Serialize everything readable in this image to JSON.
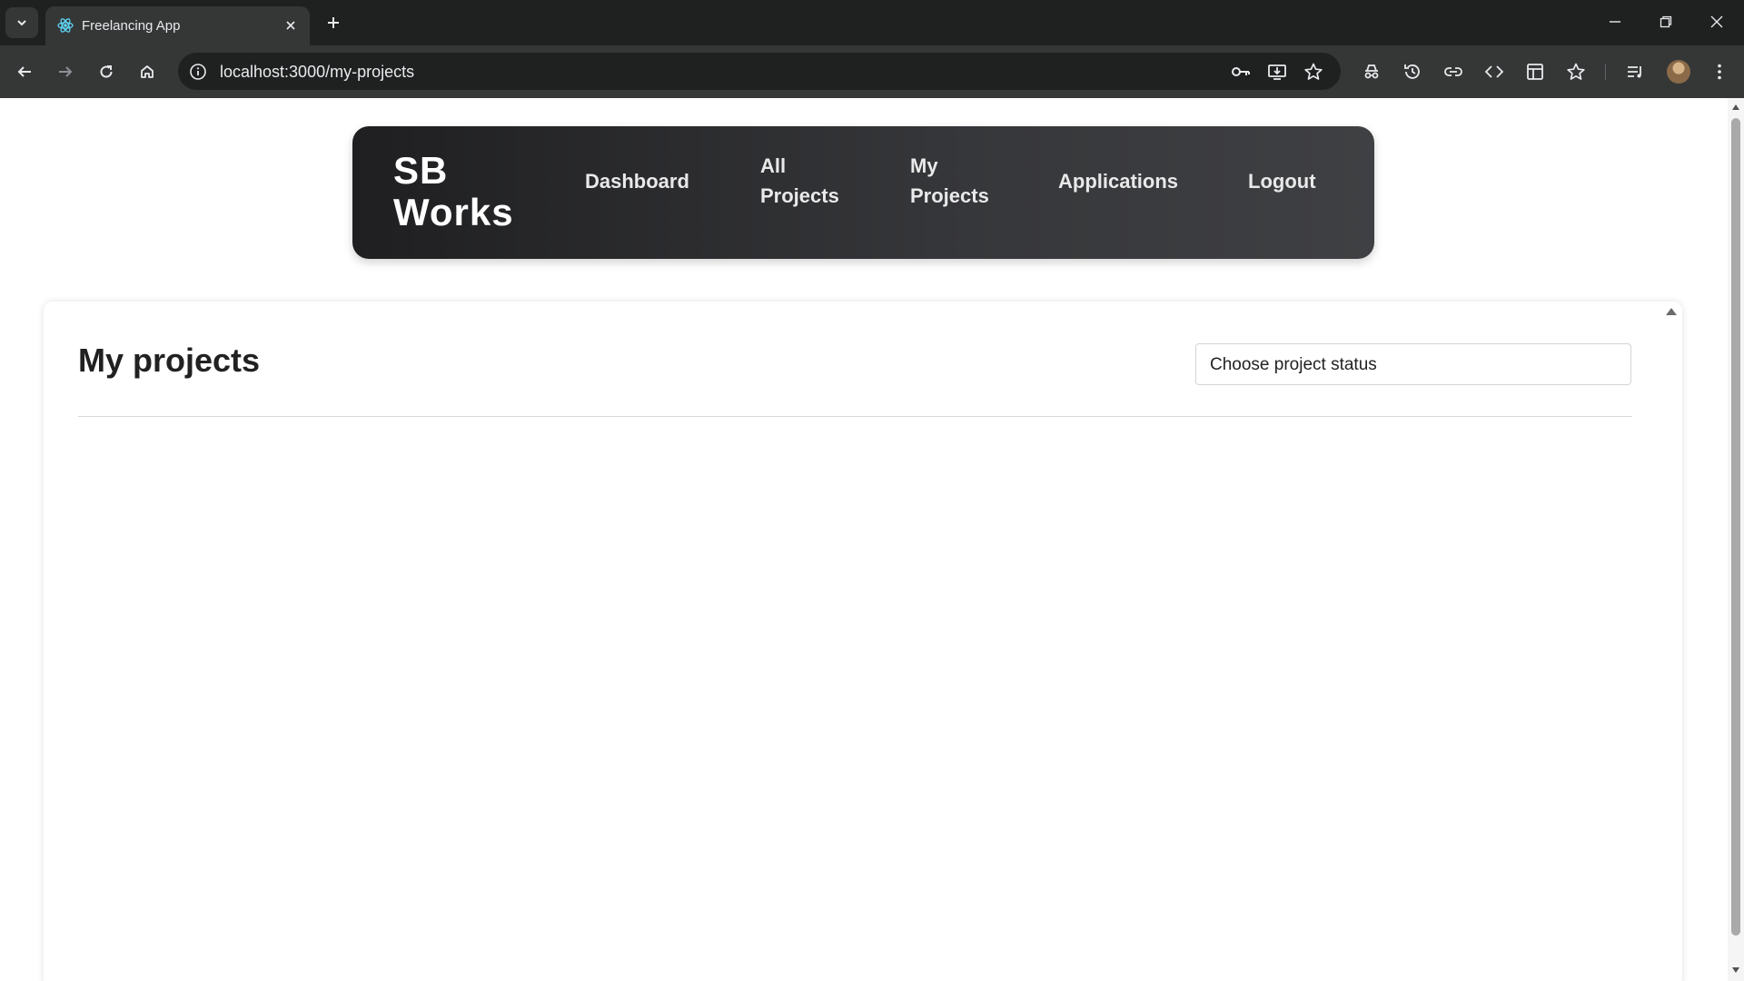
{
  "browser": {
    "tab_title": "Freelancing App",
    "url": "localhost:3000/my-projects"
  },
  "navbar": {
    "brand_line1": "SB",
    "brand_line2": "Works",
    "links": [
      {
        "line1": "Dashboard",
        "line2": ""
      },
      {
        "line1": "All",
        "line2": "Projects"
      },
      {
        "line1": "My",
        "line2": "Projects"
      },
      {
        "line1": "Applications",
        "line2": ""
      },
      {
        "line1": "Logout",
        "line2": ""
      }
    ]
  },
  "main": {
    "title": "My projects",
    "status_select": {
      "selected": "Choose project status"
    }
  },
  "colors": {
    "navbar_dark": "#1f1f21",
    "navbar_light": "#3f4043",
    "chrome_bg": "#1f2020",
    "chrome_toolbar": "#353737"
  }
}
